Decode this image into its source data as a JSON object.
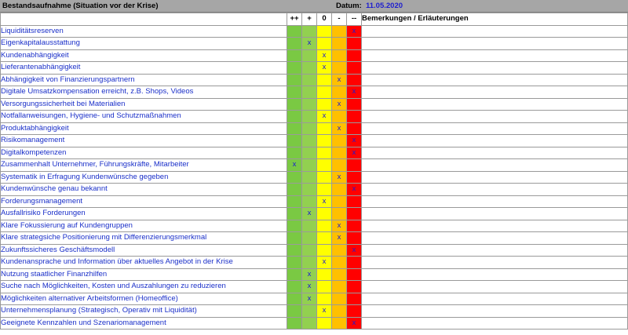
{
  "header": {
    "title": "Bestandsaufnahme (Situation vor der Krise)",
    "date_label": "Datum:",
    "date_value": "11.05.2020"
  },
  "columns": {
    "rating_labels": [
      "++",
      "+",
      "0",
      "-",
      "--"
    ],
    "remarks_label": "Bemerkungen / Erläuterungen"
  },
  "rating_colors": [
    "#7ac943",
    "#92d050",
    "#ffff00",
    "#ffc000",
    "#ff0000"
  ],
  "mark_symbol": "x",
  "rows": [
    {
      "label": "Liquiditätsreserven",
      "rating": 4
    },
    {
      "label": "Eigenkapitalausstattung",
      "rating": 1
    },
    {
      "label": "Kundenabhängigkeit",
      "rating": 2
    },
    {
      "label": "Lieferantenabhängigkeit",
      "rating": 2
    },
    {
      "label": "Abhängigkeit von Finanzierungspartnern",
      "rating": 3
    },
    {
      "label": "Digitale Umsatzkompensation erreicht, z.B. Shops, Videos",
      "rating": 4
    },
    {
      "label": "Versorgungssicherheit bei Materialien",
      "rating": 3
    },
    {
      "label": "Notfallanweisungen, Hygiene- und Schutzmaßnahmen",
      "rating": 2
    },
    {
      "label": "Produktabhängigkeit",
      "rating": 3
    },
    {
      "label": "Risikomanagement",
      "rating": 4
    },
    {
      "label": "Digitalkompetenzen",
      "rating": 4
    },
    {
      "label": "Zusammenhalt Unternehmer, Führungskräfte, Mitarbeiter",
      "rating": 0
    },
    {
      "label": "Systematik in Erfragung Kundenwünsche gegeben",
      "rating": 3
    },
    {
      "label": "Kundenwünsche genau bekannt",
      "rating": 4
    },
    {
      "label": "Forderungsmanagement",
      "rating": 2
    },
    {
      "label": "Ausfallrisiko Forderungen",
      "rating": 1
    },
    {
      "label": "Klare Fokussierung auf Kundengruppen",
      "rating": 3
    },
    {
      "label": "Klare strategsiche Positionierung mit Differenzierungsmerkmal",
      "rating": 3
    },
    {
      "label": "Zukunftssicheres Geschäftsmodell",
      "rating": 4
    },
    {
      "label": "Kundenansprache und Information über aktuelles Angebot in der Krise",
      "rating": 2
    },
    {
      "label": "Nutzung staatlicher Finanzhilfen",
      "rating": 1
    },
    {
      "label": "Suche nach Möglichkeiten, Kosten und Auszahlungen zu reduzieren",
      "rating": 1
    },
    {
      "label": "Möglichkeiten alternativer Arbeitsformen (Homeoffice)",
      "rating": 1
    },
    {
      "label": "Unternehmensplanung (Strategisch, Operativ mit Liquidität)",
      "rating": 2
    },
    {
      "label": "Geeignete Kennzahlen und Szenariomanagement",
      "rating": 4
    }
  ]
}
